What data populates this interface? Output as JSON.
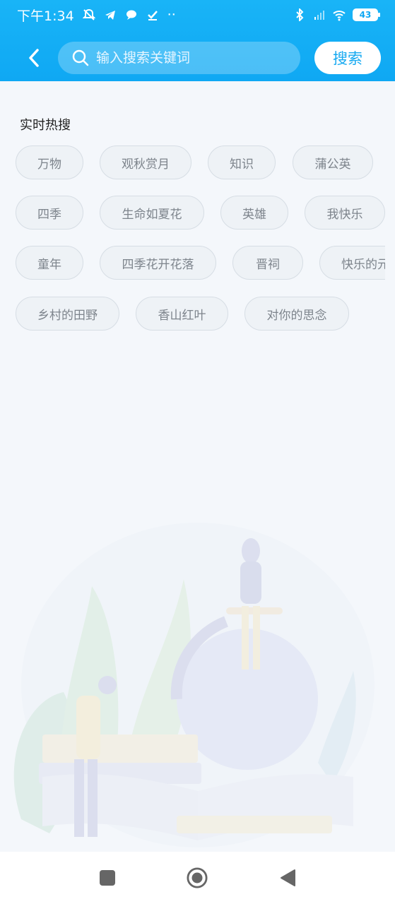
{
  "status_bar": {
    "time": "下午1:34",
    "dots": "··",
    "battery": "43"
  },
  "search": {
    "placeholder": "输入搜索关键词",
    "button_label": "搜索"
  },
  "hot_section": {
    "title": "实时热搜",
    "tags": [
      "万物",
      "观秋赏月",
      "知识",
      "蒲公英",
      "四季",
      "生命如夏花",
      "英雄",
      "我快乐",
      "童年",
      "四季花开花落",
      "晋祠",
      "快乐的元",
      "乡村的田野",
      "香山红叶",
      "对你的思念"
    ]
  },
  "colors": {
    "header": "#0fa8f3",
    "tag_bg": "#eef2f6",
    "tag_text": "#7d848c",
    "search_button_text": "#15a9f1"
  },
  "icons": [
    "back-arrow-icon",
    "search-icon",
    "bluetooth-icon",
    "signal-icon",
    "wifi-icon",
    "battery-icon",
    "square-nav-icon",
    "home-nav-icon",
    "back-nav-icon"
  ]
}
